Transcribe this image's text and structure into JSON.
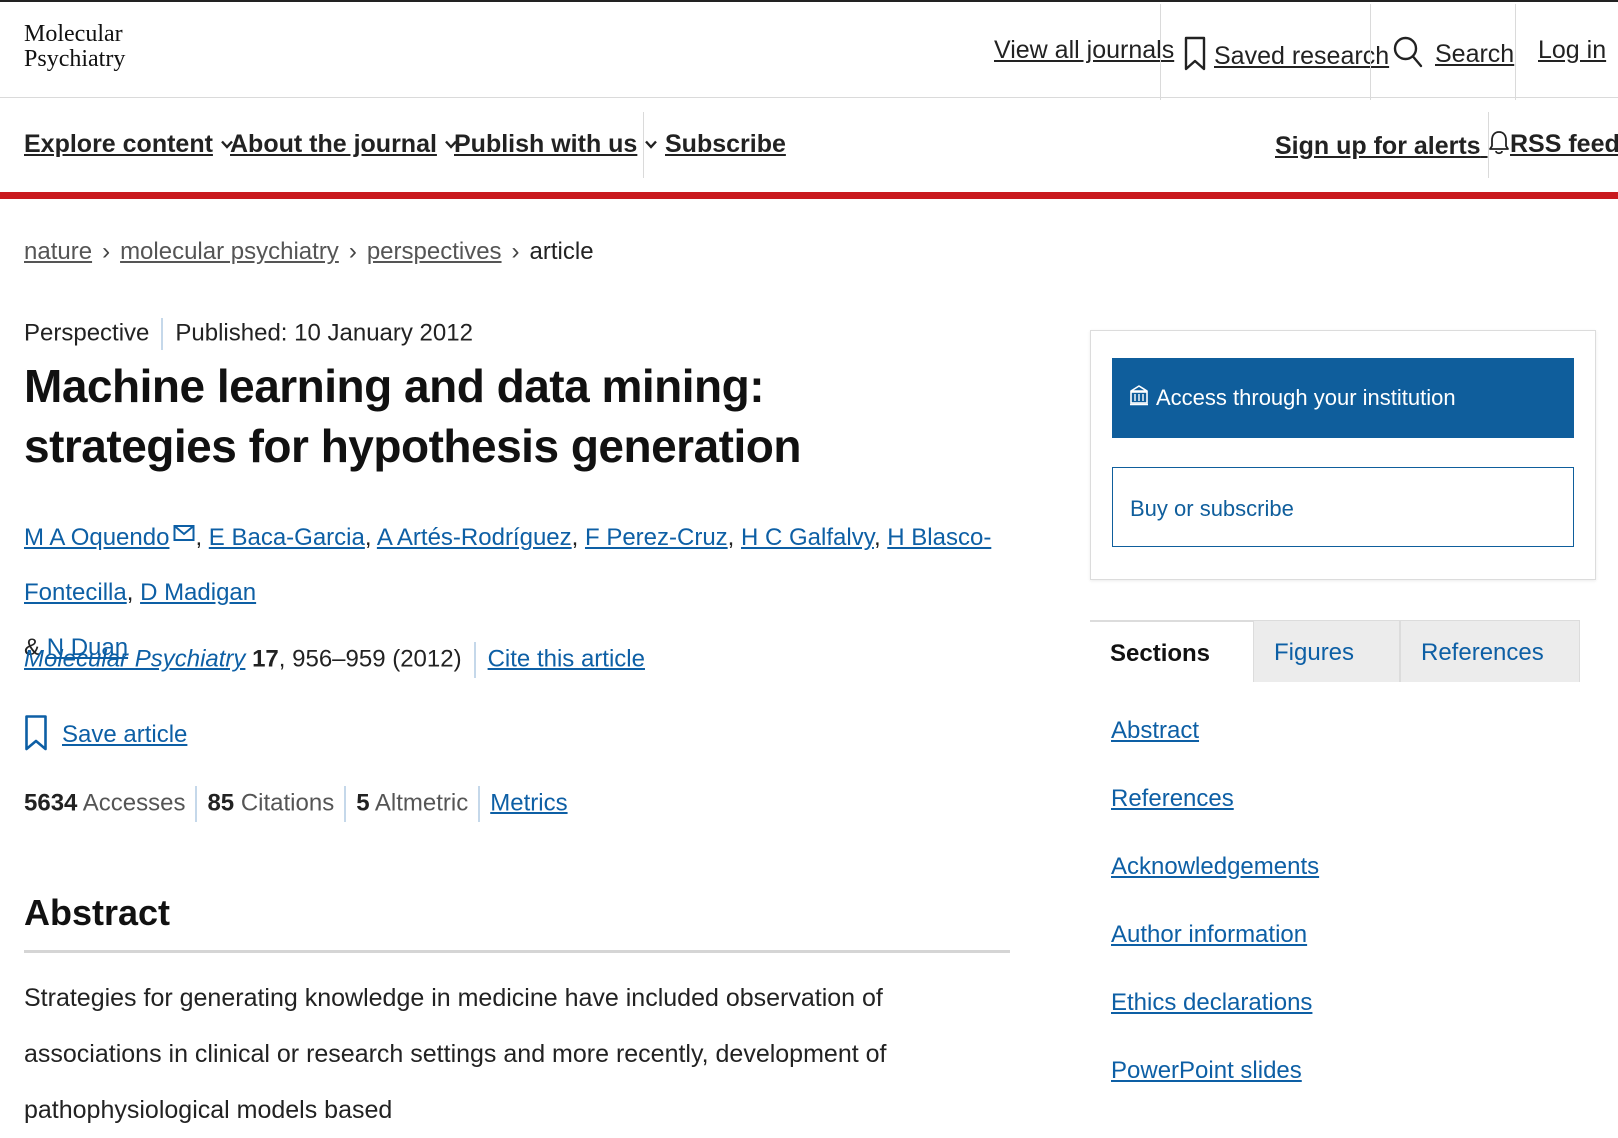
{
  "header": {
    "logo_line1": "Molecular",
    "logo_line2": "Psychiatry",
    "view_all_journals": "View all journals",
    "saved_research": "Saved research",
    "search": "Search",
    "log_in": "Log in"
  },
  "nav": {
    "explore_content": "Explore content",
    "about_journal": "About the journal",
    "publish_with_us": "Publish with us",
    "subscribe": "Subscribe",
    "sign_up_alerts": "Sign up for alerts",
    "rss_feed": "RSS feed"
  },
  "breadcrumb": [
    "nature",
    "molecular psychiatry",
    "perspectives",
    "article"
  ],
  "article": {
    "type": "Perspective",
    "published": "Published: 10 January 2012",
    "title": "Machine learning and data mining: strategies for hypothesis generation",
    "authors": [
      "M A Oquendo",
      "E Baca-Garcia",
      "A Artés-Rodríguez",
      "F Perez-Cruz",
      "H C Galfalvy",
      "H Blasco-Fontecilla",
      "D Madigan"
    ],
    "last_author_prefix": "& ",
    "last_author": "N Duan",
    "journal": "Molecular Psychiatry",
    "volume": "17",
    "pages": ", 956–959 (2012)",
    "cite": "Cite this article",
    "save": "Save article"
  },
  "metrics": {
    "accesses_value": "5634",
    "accesses_label": "Accesses",
    "citations_value": "85",
    "citations_label": "Citations",
    "altmetric_value": "5",
    "altmetric_label": "Altmetric",
    "metrics_link": "Metrics"
  },
  "abstract": {
    "heading": "Abstract",
    "text": "Strategies for generating knowledge in medicine have included observation of associations in clinical or research settings and more recently, development of pathophysiological models based"
  },
  "sidebar": {
    "institution_button": "Access through your institution",
    "buy_button": "Buy or subscribe",
    "tabs": [
      "Sections",
      "Figures",
      "References"
    ],
    "sections": [
      "Abstract",
      "References",
      "Acknowledgements",
      "Author information",
      "Ethics declarations",
      "PowerPoint slides"
    ]
  },
  "colors": {
    "brand_red": "#c9191e",
    "link_blue": "#0d5fa5",
    "button_blue": "#0f5e9c"
  }
}
